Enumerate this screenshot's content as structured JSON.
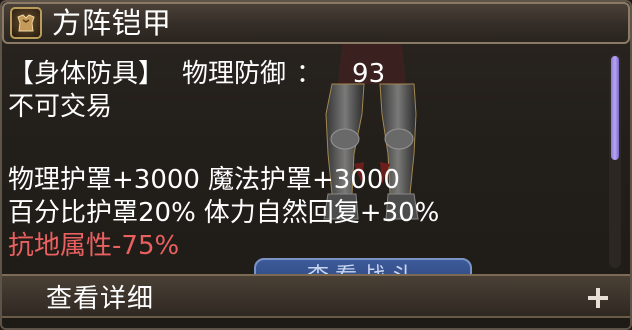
{
  "item": {
    "name": "方阵铠甲",
    "icon": "armor-item-icon"
  },
  "stats": {
    "slot": "【身体防具】",
    "defense_label": "物理防御",
    "defense_colon": "：",
    "defense_value": "93",
    "trade_status": "不可交易",
    "shields_line1_a": "物理护罩+3000",
    "shields_line1_b": "魔法护罩+3000",
    "shields_line2_a": "百分比护罩20%",
    "shields_line2_b": "体力自然回复+30%",
    "resist_label": "抗地属性",
    "resist_value": "-75%"
  },
  "hidden_button_label": "查看战斗",
  "footer": {
    "label": "查看详细",
    "expand_icon": "plus-icon"
  },
  "colors": {
    "text": "#ffffff",
    "negative_stat": "#e86060",
    "scroll_thumb": "#a493e8"
  }
}
